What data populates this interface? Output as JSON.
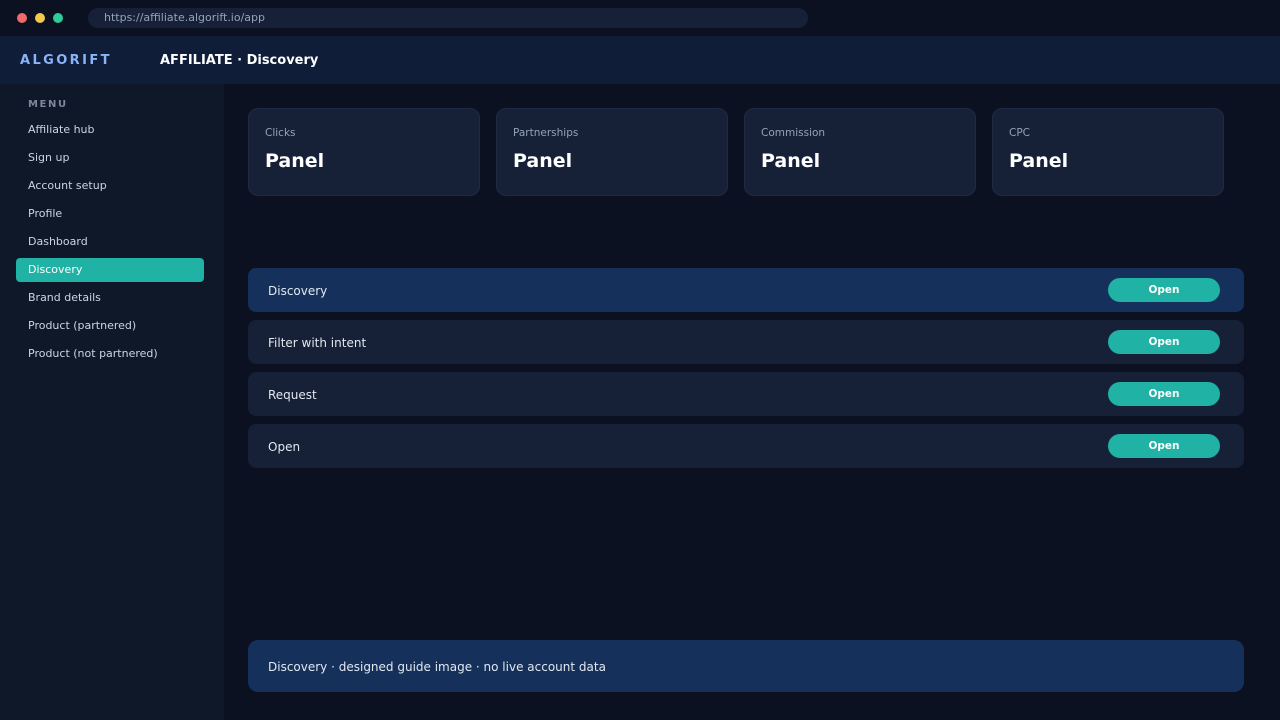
{
  "browser": {
    "url": "https://affiliate.algorift.io/app"
  },
  "app": {
    "brand": "ALGORIFT",
    "title": "AFFILIATE · Discovery"
  },
  "sidebar": {
    "heading": "MENU",
    "items": [
      {
        "label": "Affiliate hub"
      },
      {
        "label": "Sign up"
      },
      {
        "label": "Account setup"
      },
      {
        "label": "Profile"
      },
      {
        "label": "Dashboard"
      },
      {
        "label": "Discovery",
        "active": true
      },
      {
        "label": "Brand details"
      },
      {
        "label": "Product (partnered)"
      },
      {
        "label": "Product (not partnered)"
      }
    ]
  },
  "cards": [
    {
      "label": "Clicks",
      "value": "Panel"
    },
    {
      "label": "Partnerships",
      "value": "Panel"
    },
    {
      "label": "Commission",
      "value": "Panel"
    },
    {
      "label": "CPC",
      "value": "Panel"
    }
  ],
  "rows": [
    {
      "label": "Discovery",
      "button": "Open",
      "highlighted": true
    },
    {
      "label": "Filter with intent",
      "button": "Open"
    },
    {
      "label": "Request",
      "button": "Open"
    },
    {
      "label": "Open",
      "button": "Open"
    }
  ],
  "footer": {
    "note": "Discovery · designed guide image · no live account data"
  },
  "colors": {
    "accent": "#20b2a4",
    "background": "#0b1120",
    "sidebar": "#0f1829",
    "appbar": "#0f1d38",
    "card": "#162036",
    "highlight_row": "#15305a"
  }
}
